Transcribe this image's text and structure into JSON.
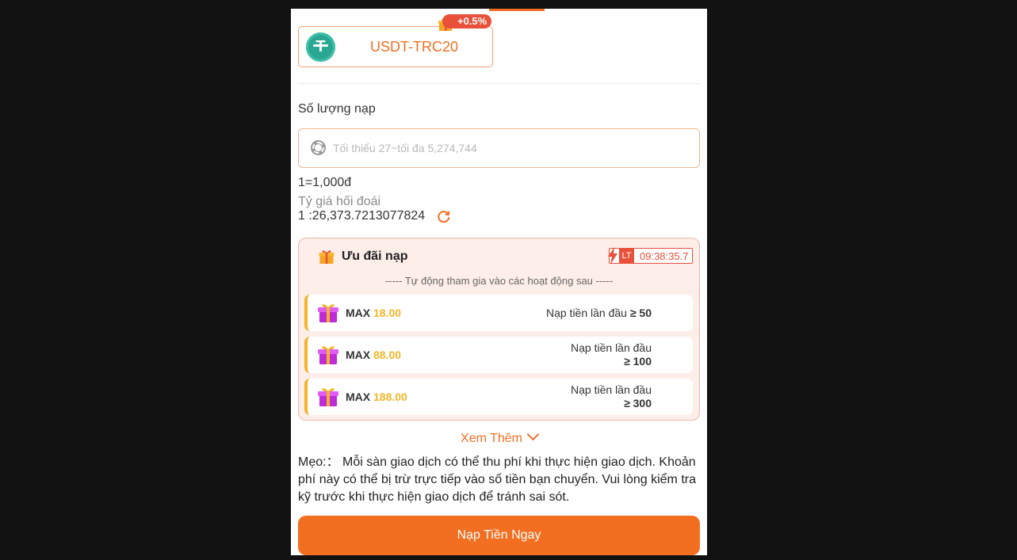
{
  "channel": {
    "name": "USDT-TRC20",
    "bonus": "+0.5%",
    "logo_icon": "tether-icon"
  },
  "amount": {
    "label": "Số lượng nạp",
    "placeholder": "Tối thiểu 27~tối đa 5,274,744",
    "unit_rate": "1=1,000đ"
  },
  "exchange": {
    "label": "Tỷ giá hối đoái",
    "value": "1 :26,373.7213077824"
  },
  "promo": {
    "title": "Ưu đãi nạp",
    "badge": "LT",
    "timer": "09:38:35.7",
    "subtitle": "----- Tự động tham gia vào các hoạt động sau -----",
    "items": [
      {
        "max_label": "MAX",
        "max_value": "18.00",
        "cond_line1": "Nạp tiền lần đầu",
        "cond_line2": "≥ 50"
      },
      {
        "max_label": "MAX",
        "max_value": "88.00",
        "cond_line1": "Nạp tiền lần đầu",
        "cond_line2": "≥ 100"
      },
      {
        "max_label": "MAX",
        "max_value": "188.00",
        "cond_line1": "Nạp tiền lần đầu",
        "cond_line2": "≥ 300"
      }
    ]
  },
  "see_more": "Xem Thêm",
  "tip": "Mẹo:： Mỗi sàn giao dịch có thể thu phí khi thực hiện giao dịch. Khoản phí này có thể bị trừ trực tiếp vào số tiền bạn chuyển. Vui lòng kiểm tra kỹ trước khi thực hiện giao dịch để tránh sai sót.",
  "submit_label": "Nạp Tiền Ngay",
  "colors": {
    "accent": "#f26f21",
    "gold": "#f5b52a",
    "red": "#e8503a",
    "tether": "#2aa793"
  }
}
